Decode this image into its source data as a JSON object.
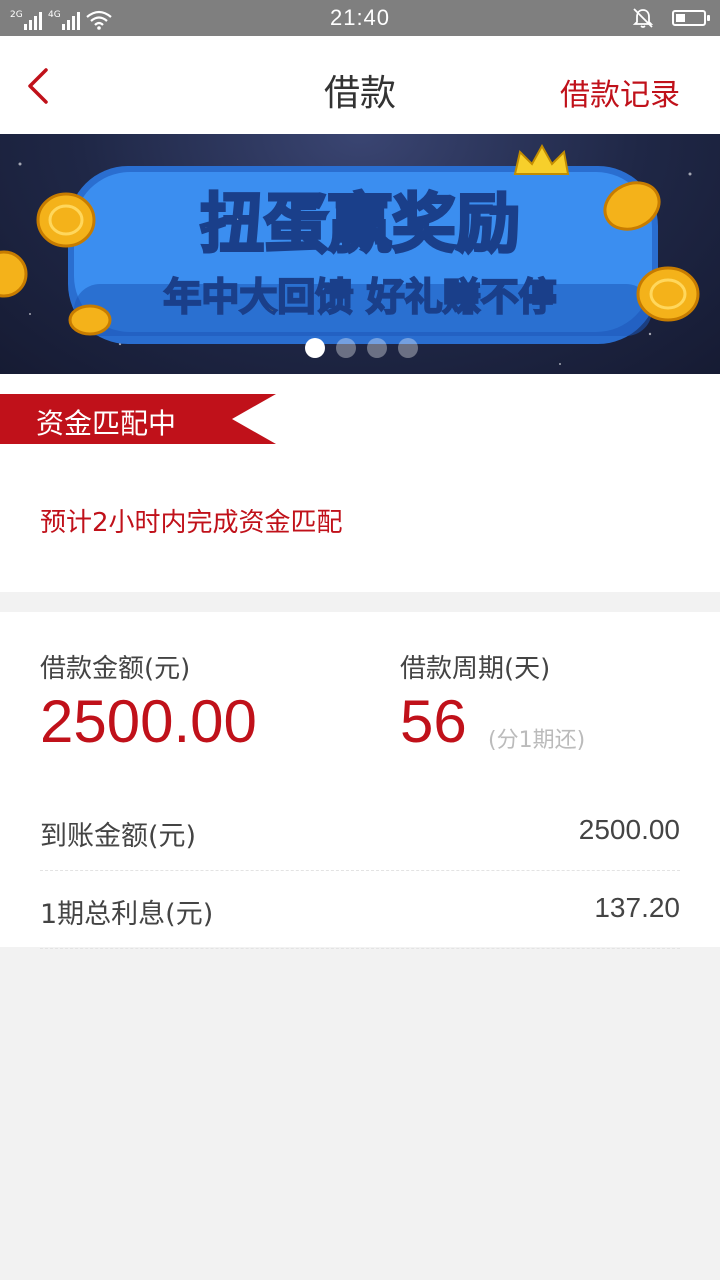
{
  "status_bar": {
    "network_1": "2G",
    "network_2": "4G",
    "time": "21:40"
  },
  "nav": {
    "title": "借款",
    "record_label": "借款记录"
  },
  "banner": {
    "headline": "扭蛋赢奖励",
    "subline": "年中大回馈 好礼赚不停",
    "page_count": 4,
    "active_page": 1
  },
  "match": {
    "tag_label": "资金匹配中",
    "note": "预计2小时内完成资金匹配"
  },
  "loan": {
    "amount_label": "借款金额(元)",
    "amount_value": "2500.00",
    "period_label": "借款周期(天)",
    "period_value": "56",
    "period_note": "(分1期还)"
  },
  "rows": [
    {
      "label": "到账金额(元)",
      "value": "2500.00"
    },
    {
      "label": "1期总利息(元)",
      "value": "137.20"
    }
  ],
  "colors": {
    "accent": "#c0111a",
    "statusbar": "#7f7f7f",
    "page_bg": "#f2f2f2"
  }
}
